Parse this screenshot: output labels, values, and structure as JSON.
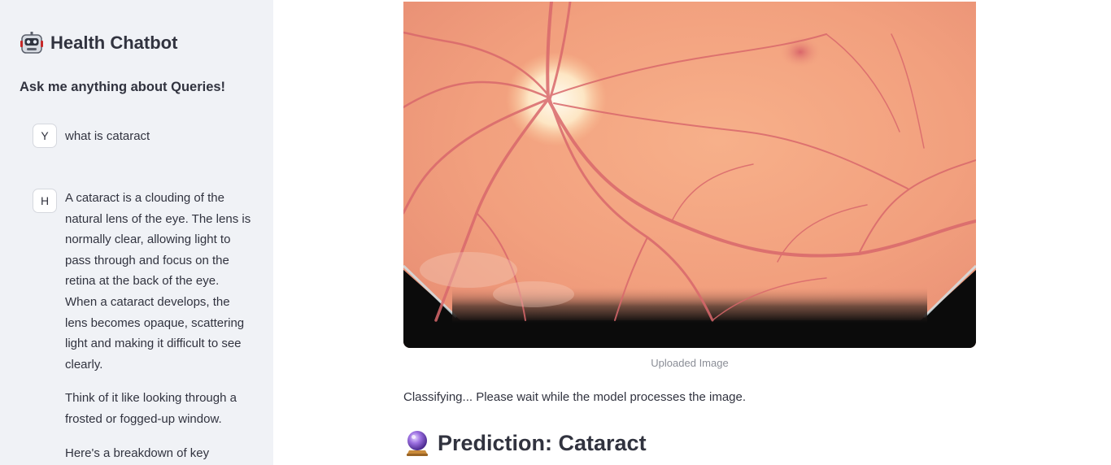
{
  "sidebar": {
    "app_title": "Health Chatbot",
    "subtitle": "Ask me anything about Queries!",
    "messages": [
      {
        "avatar": "Y",
        "text": "what is cataract"
      },
      {
        "avatar": "H",
        "paragraphs": [
          "A cataract is a clouding of the natural lens of the eye. The lens is normally clear, allowing light to pass through and focus on the retina at the back of the eye. When a cataract develops, the lens becomes opaque, scattering light and making it difficult to see clearly.",
          "Think of it like looking through a frosted or fogged-up window.",
          "Here's a breakdown of key"
        ]
      }
    ]
  },
  "main": {
    "image_caption": "Uploaded Image",
    "status_text": "Classifying... Please wait while the model processes the image.",
    "prediction_title": "Prediction: Cataract"
  },
  "icons": {
    "app": "robot-face-icon",
    "prediction": "crystal-ball-icon"
  }
}
